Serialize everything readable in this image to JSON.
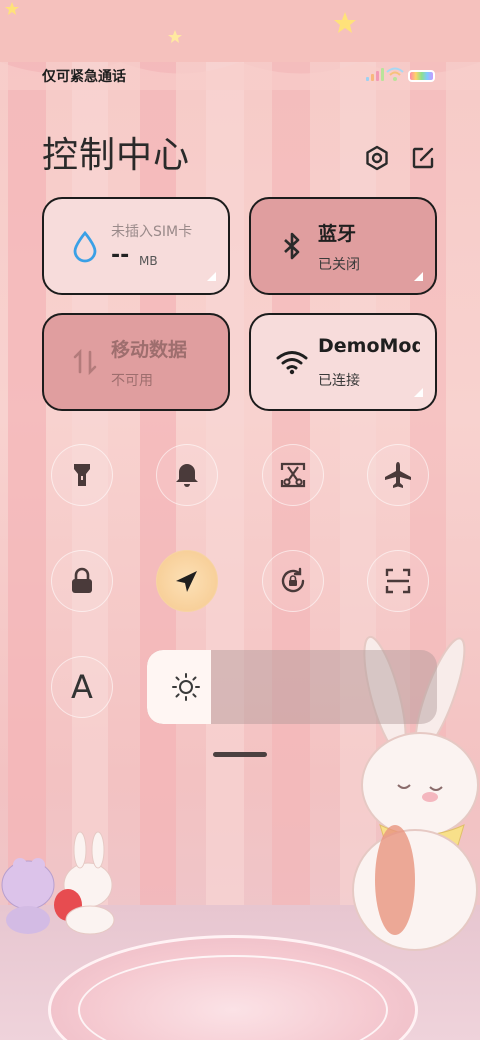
{
  "status_bar": {
    "carrier_text": "仅可紧急通话"
  },
  "header": {
    "title": "控制中心",
    "settings_icon": "gear-icon",
    "edit_icon": "edit-icon"
  },
  "tiles": {
    "data_usage": {
      "label": "未插入SIM卡",
      "value": "--",
      "unit": "MB",
      "icon": "water-drop-icon"
    },
    "bluetooth": {
      "label": "蓝牙",
      "status": "已关闭",
      "icon": "bluetooth-icon"
    },
    "mobile_data": {
      "label": "移动数据",
      "status": "不可用",
      "icon": "data-arrows-icon"
    },
    "wifi": {
      "label": "DemoMode",
      "status": "已连接",
      "icon": "wifi-icon"
    }
  },
  "toggles": [
    {
      "name": "flashlight",
      "icon": "flashlight-icon",
      "active": false
    },
    {
      "name": "ring",
      "icon": "bell-icon",
      "active": false
    },
    {
      "name": "screenshot",
      "icon": "scissors-icon",
      "active": false
    },
    {
      "name": "airplane",
      "icon": "airplane-icon",
      "active": false
    },
    {
      "name": "lock",
      "icon": "lock-icon",
      "active": false
    },
    {
      "name": "location",
      "icon": "location-arrow-icon",
      "active": true
    },
    {
      "name": "rotation-lock",
      "icon": "rotate-lock-icon",
      "active": false
    },
    {
      "name": "scanner",
      "icon": "scan-icon",
      "active": false
    },
    {
      "name": "font-size",
      "icon": "font-a-icon",
      "glyph": "A",
      "active": false
    }
  ],
  "brightness": {
    "level": 0.22,
    "icon": "sun-icon"
  },
  "colors": {
    "tile_dark": "#e09e9f",
    "tile_light": "#f7dcdb",
    "accent_on": "#f6c98e"
  }
}
